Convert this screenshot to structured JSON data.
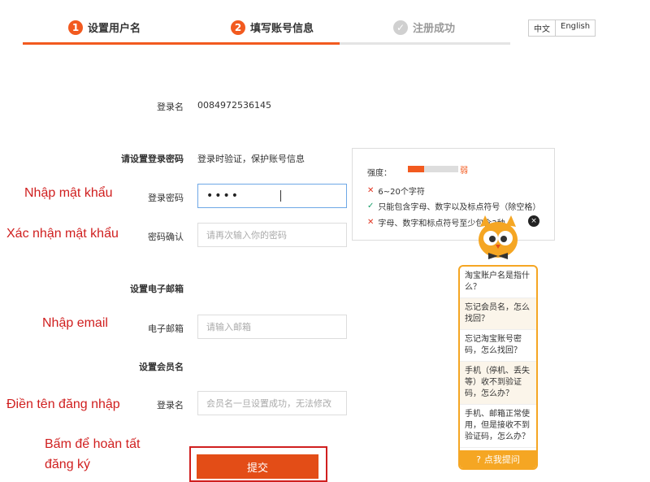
{
  "steps": [
    {
      "num": "1",
      "label": "设置用户名"
    },
    {
      "num": "2",
      "label": "填写账号信息"
    },
    {
      "label": "注册成功"
    }
  ],
  "lang": {
    "zh": "中文",
    "en": "English"
  },
  "form": {
    "login_label": "登录名",
    "login_value": "0084972536145",
    "pwd_section": "请设置登录密码",
    "pwd_section_hint": "登录时验证，保护账号信息",
    "pwd_label": "登录密码",
    "pwd_value": "••••",
    "confirm_label": "密码确认",
    "confirm_placeholder": "请再次输入你的密码",
    "email_section": "设置电子邮箱",
    "email_label": "电子邮箱",
    "email_placeholder": "请输入邮箱",
    "member_section": "设置会员名",
    "member_label": "登录名",
    "member_placeholder": "会员名一旦设置成功，无法修改",
    "submit_label": "提交"
  },
  "tooltip": {
    "strength_label": "强度：",
    "strength_value": "弱",
    "strength_level": 0.33,
    "rules": [
      {
        "status": "fail",
        "text": "6~20个字符"
      },
      {
        "status": "pass",
        "text": "只能包含字母、数字以及标点符号（除空格）"
      },
      {
        "status": "fail",
        "text": "字母、数字和标点符号至少包含2种"
      }
    ],
    "close_icon": "×"
  },
  "help": {
    "questions": [
      "淘宝账户名是指什么？",
      "忘记会员名，怎么找回？",
      "忘记淘宝账号密码，怎么找回？",
      "手机（停机、丢失等）收不到验证码，怎么办？",
      "手机、邮箱正常使用，但是接收不到验证码，怎么办？"
    ],
    "footer": "点我提问"
  },
  "notes": {
    "password": "Nhập mật khẩu",
    "confirm": "Xác nhận mật khẩu",
    "email": "Nhập email",
    "username": "Điền tên đăng nhập",
    "submit_line1": "Bấm để hoàn tất",
    "submit_line2": "đăng ký"
  },
  "colors": {
    "accent": "#f25a1f",
    "annotation": "#d01f1f",
    "help_border": "#f5a623"
  }
}
